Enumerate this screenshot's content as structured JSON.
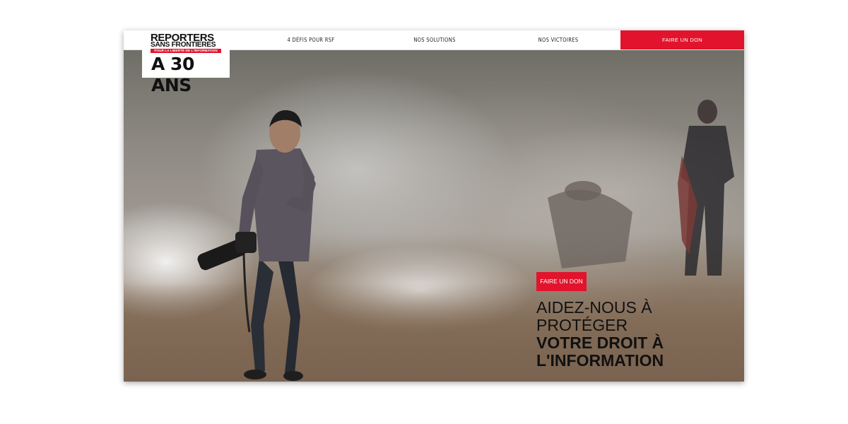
{
  "logo": {
    "line1": "REPORTERS",
    "line2": "SANS FRONTIERES",
    "tagline": "POUR LA LIBERTÉ DE L'INFORMATION",
    "line4": "A 30 ANS"
  },
  "nav": {
    "items": [
      "4 DÉFIS POUR RSF",
      "NOS SOLUTIONS",
      "NOS VICTOIRES"
    ],
    "donate": "FAIRE UN DON"
  },
  "hero": {
    "donate_button": "FAIRE UN DON",
    "headline_line1": "AIDEZ-NOUS À",
    "headline_line2": "PROTÉGER",
    "headline_line3": "VOTRE DROIT À",
    "headline_line4": "L'INFORMATION"
  },
  "colors": {
    "accent": "#e2142d",
    "text": "#111111"
  }
}
